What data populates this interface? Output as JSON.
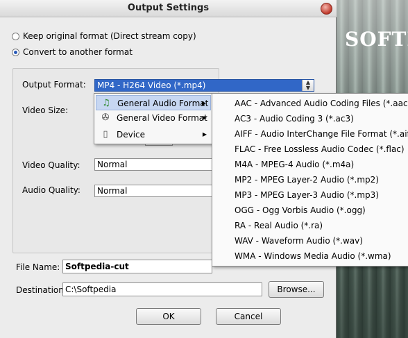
{
  "background": {
    "brand_text": "SOFTP"
  },
  "dialog": {
    "title": "Output Settings",
    "radio_keep": "Keep original format (Direct stream copy)",
    "radio_convert": "Convert to another format",
    "output_format_label": "Output Format:",
    "output_format_value": "MP4 - H264 Video (*.mp4)",
    "video_size_label": "Video Size:",
    "video_quality_label": "Video Quality:",
    "video_quality_value": "Normal",
    "audio_quality_label": "Audio Quality:",
    "audio_quality_value": "Normal",
    "file_name_label": "File Name:",
    "file_name_value": "Softpedia-cut",
    "destination_label": "Destination:",
    "destination_value": "C:\\Softpedia",
    "browse_label": "Browse...",
    "ok_label": "OK",
    "cancel_label": "Cancel"
  },
  "format_menu": {
    "items": [
      {
        "label": "General Audio Format",
        "icon": "music-note-icon",
        "highlighted": true
      },
      {
        "label": "General Video Format",
        "icon": "film-reel-icon",
        "highlighted": false
      },
      {
        "label": "Device",
        "icon": "device-icon",
        "highlighted": false
      }
    ]
  },
  "audio_submenu": {
    "items": [
      "AAC - Advanced Audio Coding Files (*.aac)",
      "AC3 - Audio Coding 3 (*.ac3)",
      "AIFF - Audio InterChange File Format (*.aiff)",
      "FLAC - Free Lossless Audio Codec (*.flac)",
      "M4A - MPEG-4 Audio (*.m4a)",
      "MP2 - MPEG Layer-2 Audio (*.mp2)",
      "MP3 - MPEG Layer-3 Audio (*.mp3)",
      "OGG - Ogg Vorbis Audio (*.ogg)",
      "RA - Real Audio (*.ra)",
      "WAV - Waveform Audio (*.wav)",
      "WMA - Windows Media Audio (*.wma)"
    ]
  },
  "colors": {
    "selection": "#3167c7",
    "menu_highlight": "#c7d7f2"
  }
}
